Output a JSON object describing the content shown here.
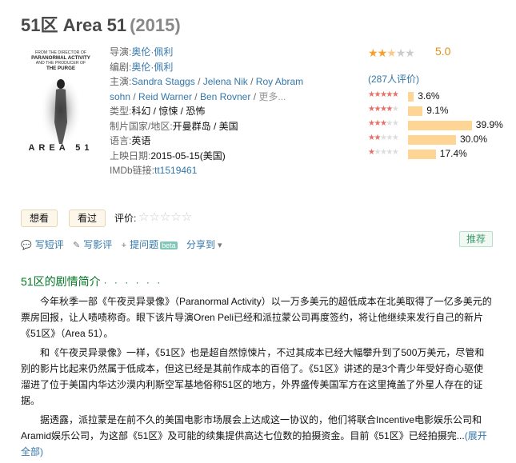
{
  "movie": {
    "title": "51区 Area 51",
    "year": "(2015)"
  },
  "poster": {
    "tagline_line1": "FROM THE DIRECTOR OF",
    "tagline_line2": "PARANORMAL ACTIVITY",
    "tagline_line3": "AND THE PRODUCER OF",
    "tagline_line4": "THE PURGE",
    "poster_title": "AREA 51"
  },
  "info": {
    "director_label": "导演:",
    "director": "奥伦·佩利",
    "writer_label": "编剧:",
    "writer": "奥伦·佩利",
    "cast_label": "主演:",
    "cast": [
      "Sandra Staggs",
      "Jelena Nik",
      "Roy Abram",
      "sohn",
      "Reid Warner",
      "Ben Rovner"
    ],
    "cast_sep": " / ",
    "cast_more": "更多...",
    "genre_label": "类型:",
    "genres": "科幻 / 惊悚 / 恐怖",
    "country_label": "制片国家/地区:",
    "country": "开曼群岛 / 美国",
    "language_label": "语言:",
    "language": "英语",
    "release_label": "上映日期:",
    "release": "2015-05-15(美国)",
    "imdb_label": "IMDb链接:",
    "imdb": "tt1519461"
  },
  "rating": {
    "score": "5.0",
    "stars_value": 2.5,
    "count": "(287人评价)",
    "histogram": [
      {
        "stars": 5,
        "percent": 3.6,
        "label": "3.6%"
      },
      {
        "stars": 4,
        "percent": 9.1,
        "label": "9.1%"
      },
      {
        "stars": 3,
        "percent": 39.9,
        "label": "39.9%"
      },
      {
        "stars": 2,
        "percent": 30.0,
        "label": "30.0%"
      },
      {
        "stars": 1,
        "percent": 17.4,
        "label": "17.4%"
      }
    ],
    "colors": {
      "star_main": "#f7a02b",
      "star_hist": "#e4706a",
      "bar": "#ffd596",
      "score": "#e09015"
    }
  },
  "actions": {
    "want": "想看",
    "seen": "看过",
    "rate_label": "评价:",
    "empty_stars": "☆☆☆☆☆"
  },
  "links": {
    "short_review": "写短评",
    "review": "写影评",
    "question": "提问题",
    "beta": "beta",
    "share": "分享到",
    "recommend": "推荐"
  },
  "synopsis": {
    "heading": "51区的剧情简介",
    "dots": "· · · · · ·",
    "p1": "今年秋季一部《午夜灵异录像》（Paranormal Activity）以一万多美元的超低成本在北美取得了一亿多美元的票房回报，让人啧啧称奇。眼下该片导演Oren Peli已经和派拉蒙公司再度签约，将让他继续来发行自己的新片《51区》（Area 51）。",
    "p2": "和《午夜灵异录像》一样，《51区》也是超自然惊悚片，不过其成本已经大幅攀升到了500万美元，尽管和别的影片比起来仍然属于低成本，但这已经是其前作成本的百倍了。《51区》讲述的是3个青少年受好奇心驱使溜进了位于美国内华达沙漠内利斯空军基地俗称51区的地方，外界盛传美国军方在这里掩盖了外星人存在的证据。",
    "p3": "据透露，派拉蒙是在前不久的美国电影市场展会上达成这一协议的，他们将联合Incentive电影娱乐公司和Aramid娱乐公司，为这部《51区》及可能的续集提供高达七位数的拍摄资金。目前《51区》已经拍摄完...",
    "more": "(展开全部)"
  }
}
